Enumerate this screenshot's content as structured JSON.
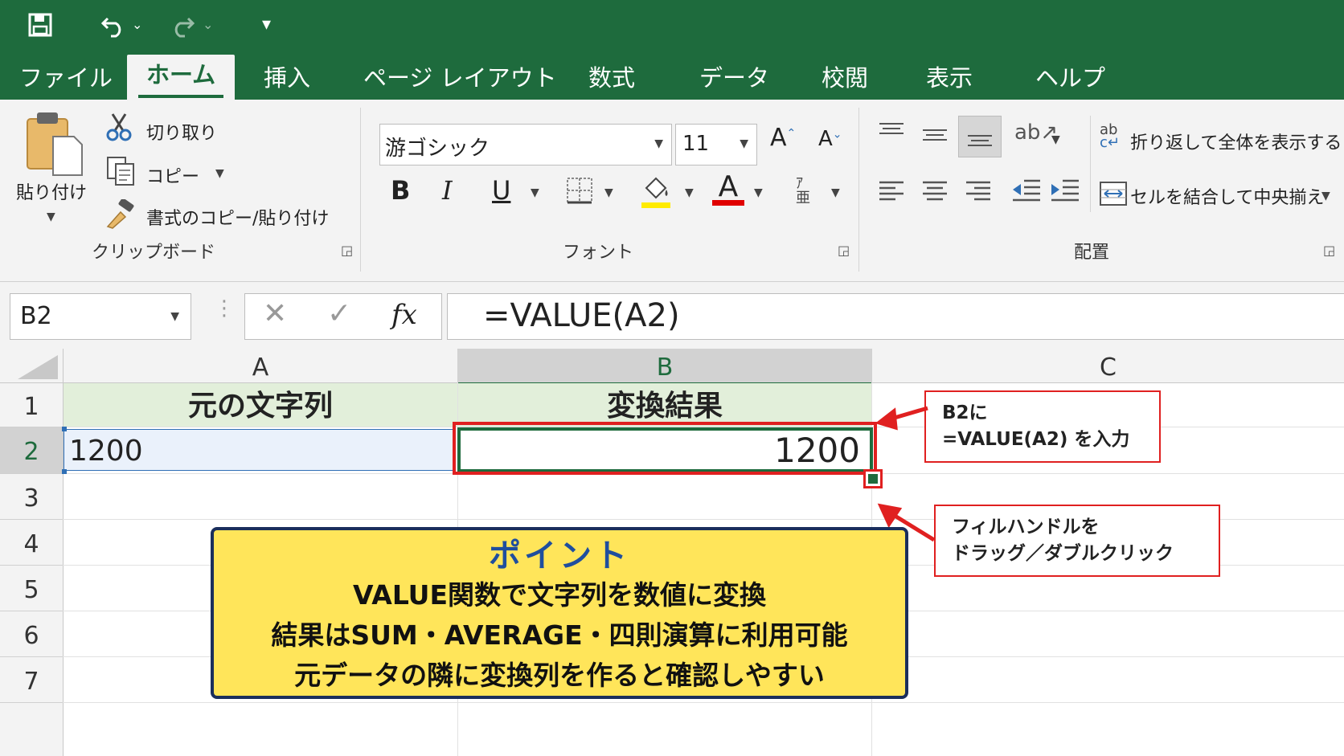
{
  "colors": {
    "excel_green": "#1e6b3d",
    "callout_red": "#e02020",
    "point_yellow": "#ffe55a",
    "point_title_blue": "#1f4e9e"
  },
  "qat": {
    "save_icon": "save-icon",
    "undo_icon": "undo-icon",
    "redo_icon": "redo-icon",
    "customize_icon": "customize-qat-icon"
  },
  "tabs": [
    "ファイル",
    "ホーム",
    "挿入",
    "ページ レイアウト",
    "数式",
    "データ",
    "校閲",
    "表示",
    "ヘルプ"
  ],
  "ribbon": {
    "clipboard": {
      "paste": "貼り付け",
      "cut": "切り取り",
      "copy": "コピー",
      "format_painter": "書式のコピー/貼り付け",
      "group": "クリップボード"
    },
    "font": {
      "font_name": "游ゴシック",
      "font_size": "11",
      "bold": "B",
      "italic": "I",
      "underline": "U",
      "grow": "A",
      "shrink": "A",
      "color_letter": "A",
      "group": "フォント"
    },
    "alignment": {
      "wrap_text": "折り返して全体を表示する",
      "merge_center": "セルを結合して中央揃え",
      "group": "配置"
    }
  },
  "formula_bar": {
    "name_box": "B2",
    "formula": "=VALUE(A2)",
    "fx": "fx"
  },
  "columns": [
    "A",
    "B",
    "C"
  ],
  "rows": [
    "1",
    "2",
    "3",
    "4",
    "5",
    "6",
    "7"
  ],
  "cells": {
    "A1": "元の文字列",
    "B1": "変換結果",
    "A2": "1200",
    "B2": "1200"
  },
  "callouts": {
    "input_line1": "B2に",
    "input_line2": "=VALUE(A2) を入力",
    "fill_line1": "フィルハンドルを",
    "fill_line2": "ドラッグ／ダブルクリック"
  },
  "point": {
    "title": "ポイント",
    "line1": "VALUE関数で文字列を数値に変換",
    "line2": "結果はSUM・AVERAGE・四則演算に利用可能",
    "line3": "元データの隣に変換列を作ると確認しやすい"
  }
}
